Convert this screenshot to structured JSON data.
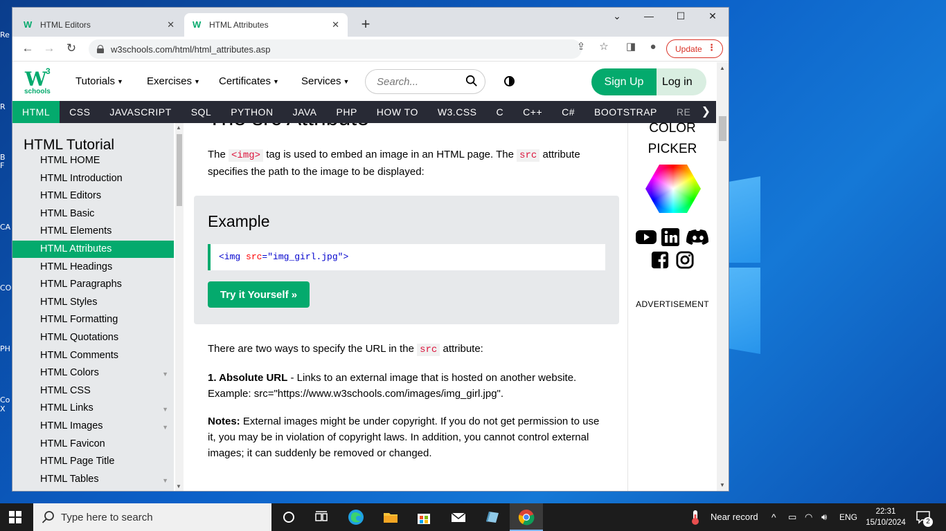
{
  "desktop": {
    "icon_labels": [
      "Re",
      "R",
      "B F",
      "CA",
      "CO",
      "PH",
      "Co X"
    ]
  },
  "browser": {
    "tabs": [
      {
        "title": "HTML Editors",
        "close": "✕"
      },
      {
        "title": "HTML Attributes",
        "close": "✕"
      }
    ],
    "new_tab": "+",
    "url": "w3schools.com/html/html_attributes.asp",
    "update_label": "Update"
  },
  "site": {
    "logo_letter": "W",
    "logo_sup": "3",
    "logo_text": "schools",
    "menu": [
      "Tutorials",
      "Exercises",
      "Certificates",
      "Services"
    ],
    "search_placeholder": "Search...",
    "signup": "Sign Up",
    "login": "Log in",
    "subnav": [
      "HTML",
      "CSS",
      "JAVASCRIPT",
      "SQL",
      "PYTHON",
      "JAVA",
      "PHP",
      "HOW TO",
      "W3.CSS",
      "C",
      "C++",
      "C#",
      "BOOTSTRAP",
      "RE"
    ]
  },
  "sidebar": {
    "title": "HTML Tutorial",
    "items": [
      "HTML HOME",
      "HTML Introduction",
      "HTML Editors",
      "HTML Basic",
      "HTML Elements",
      "HTML Attributes",
      "HTML Headings",
      "HTML Paragraphs",
      "HTML Styles",
      "HTML Formatting",
      "HTML Quotations",
      "HTML Comments",
      "HTML Colors",
      "HTML CSS",
      "HTML Links",
      "HTML Images",
      "HTML Favicon",
      "HTML Page Title",
      "HTML Tables"
    ],
    "active_index": 5
  },
  "content": {
    "heading": "The src Attribute",
    "p1_a": "The ",
    "p1_code1": "<img>",
    "p1_b": " tag is used to embed an image in an HTML page. The ",
    "p1_code2": "src",
    "p1_c": " attribute specifies the path to the image to be displayed:",
    "example_title": "Example",
    "code_open": "<img ",
    "code_attr": "src",
    "code_eq": "=",
    "code_val": "\"img_girl.jpg\"",
    "code_close": ">",
    "try_it": "Try it Yourself »",
    "p2_a": "There are two ways to specify the URL in the ",
    "p2_code": "src",
    "p2_b": " attribute:",
    "p3_bold": "1. Absolute URL",
    "p3_text": " - Links to an external image that is hosted on another website. Example: src=\"https://www.w3schools.com/images/img_girl.jpg\".",
    "p4_bold": "Notes:",
    "p4_text": " External images might be under copyright. If you do not get permission to use it, you may be in violation of copyright laws. In addition, you cannot control external images; it can suddenly be removed or changed."
  },
  "right": {
    "cp1": "COLOR",
    "cp2": "PICKER",
    "advert": "ADVERTISEMENT"
  },
  "taskbar": {
    "search_placeholder": "Type here to search",
    "weather": "Near record",
    "lang": "ENG",
    "time": "22:31",
    "date": "15/10/2024",
    "notif_count": "2"
  }
}
